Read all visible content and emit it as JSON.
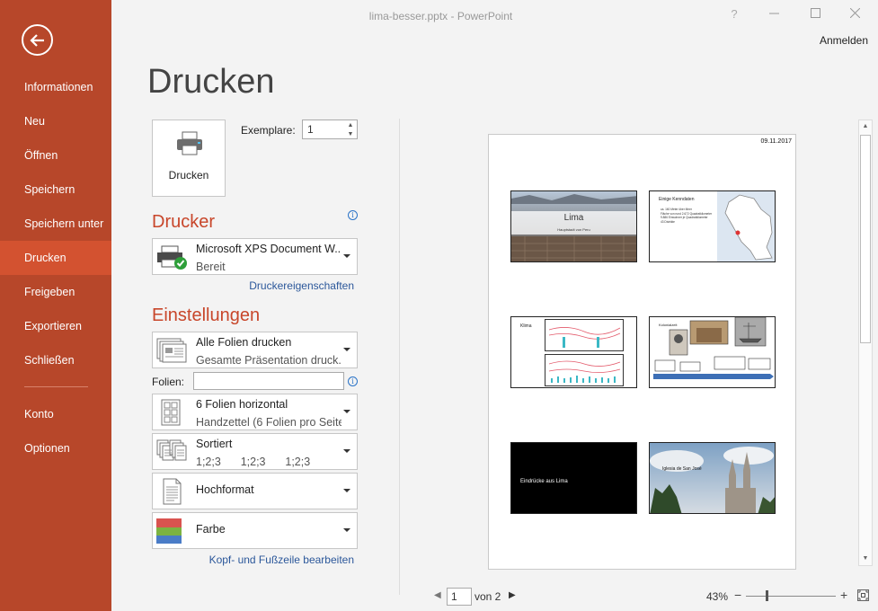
{
  "window": {
    "title": "lima-besser.pptx - PowerPoint",
    "help": "?",
    "signin": "Anmelden"
  },
  "sidebar": {
    "items": [
      {
        "label": "Informationen"
      },
      {
        "label": "Neu"
      },
      {
        "label": "Öffnen"
      },
      {
        "label": "Speichern"
      },
      {
        "label": "Speichern unter"
      },
      {
        "label": "Drucken",
        "active": true
      },
      {
        "label": "Freigeben"
      },
      {
        "label": "Exportieren"
      },
      {
        "label": "Schließen"
      },
      {
        "label": "Konto"
      },
      {
        "label": "Optionen"
      }
    ],
    "accent": "#b7472a",
    "active_color": "#d35230"
  },
  "page": {
    "title": "Drucken",
    "print_button": "Drucken",
    "copies_label": "Exemplare:",
    "copies_value": "1"
  },
  "printer": {
    "heading": "Drucker",
    "name": "Microsoft XPS Document W...",
    "status": "Bereit",
    "properties_link": "Druckereigenschaften"
  },
  "settings": {
    "heading": "Einstellungen",
    "range": {
      "title": "Alle Folien drucken",
      "subtitle": "Gesamte Präsentation druck..."
    },
    "slides_label": "Folien:",
    "slides_value": "",
    "layout": {
      "title": "6 Folien horizontal",
      "subtitle": "Handzettel (6 Folien pro Seite)"
    },
    "collate": {
      "title": "Sortiert",
      "subtitle": "1;2;3    1;2;3    1;2;3"
    },
    "orientation": {
      "title": "Hochformat"
    },
    "color": {
      "title": "Farbe"
    },
    "header_footer_link": "Kopf- und Fußzeile bearbeiten"
  },
  "preview": {
    "date": "09.11.2017",
    "slides": [
      {
        "title": "Lima",
        "subtitle": "Hauptstadt von Peru"
      },
      {
        "title": "Einige Kenndaten",
        "bullets": [
          "ca. 160 Meter über Meer",
          "Fläche von rund 2.672 Quadratkilometer",
          "9.886 Einwohner je Quadratkilometer",
          "43 Distrikte"
        ]
      },
      {
        "title": "Klima"
      },
      {
        "title": "Kolonialzeit"
      },
      {
        "title": "Eindrücke aus Lima"
      },
      {
        "title": "Iglesia de San José"
      }
    ]
  },
  "status": {
    "current_page": "1",
    "of_pages": "von 2",
    "zoom": "43%",
    "zoom_fraction": 0.43
  }
}
